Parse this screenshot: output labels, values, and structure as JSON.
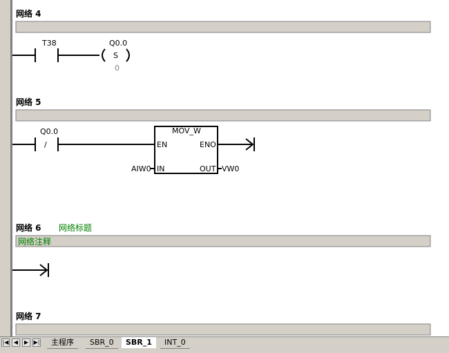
{
  "networks": [
    {
      "title": "网络 4",
      "subtitle": "",
      "comment": ""
    },
    {
      "title": "网络 5",
      "subtitle": "",
      "comment": ""
    },
    {
      "title": "网络 6",
      "subtitle": "网络标题",
      "comment": "网络注释"
    },
    {
      "title": "网络 7",
      "subtitle": "",
      "comment": ""
    }
  ],
  "network4": {
    "contact_label": "T38",
    "coil_label": "Q0.0",
    "coil_type": "S",
    "coil_count": "0"
  },
  "network5": {
    "contact_label": "Q0.0",
    "contact_type": "/",
    "box_title": "MOV_W",
    "en_label": "EN",
    "eno_label": "ENO",
    "in_label": "IN",
    "out_label": "OUT",
    "in_operand": "AIW0",
    "out_operand": "VW0"
  },
  "tabs": [
    {
      "label": "主程序",
      "active": false
    },
    {
      "label": "SBR_0",
      "active": false
    },
    {
      "label": "SBR_1",
      "active": true
    },
    {
      "label": "INT_0",
      "active": false
    }
  ],
  "nav_buttons": [
    "first",
    "prev",
    "next",
    "last"
  ],
  "colors": {
    "comment_bar": "#d4d0c8",
    "title_text": "#008000",
    "rail": "#808080"
  }
}
